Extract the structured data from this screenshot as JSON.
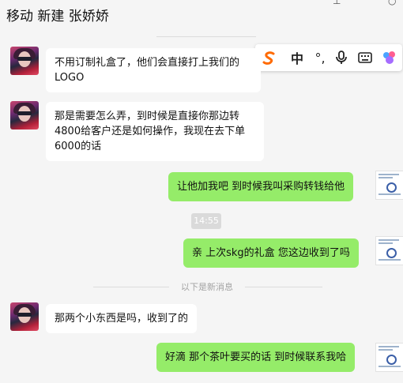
{
  "header": {
    "title": "移动 新建 张娇娇",
    "icons": [
      "minus-icon",
      "close-icon"
    ]
  },
  "ime_toolbar": {
    "logo_glyph": "S",
    "mode_label": "中",
    "punct_label": "°,",
    "icons": [
      "microphone-icon",
      "keyboard-icon",
      "skin-icon"
    ]
  },
  "messages": [
    {
      "side": "left",
      "text_lines": [
        "不用订制礼盒了，他们会直接打上我们的",
        "LOGO"
      ]
    },
    {
      "side": "left",
      "text_lines": [
        "那是需要怎么弄，到时候是直接你那边转",
        "4800给客户还是如何操作，我现在去下单",
        "6000的话"
      ]
    },
    {
      "side": "right",
      "text": "让他加我吧  到时候我叫采购转钱给他"
    },
    {
      "side": "right",
      "text": "亲 上次skg的礼盒 您这边收到了吗"
    },
    {
      "side": "left",
      "text": "那两个小东西是吗，收到了的"
    },
    {
      "side": "right",
      "text": "好滴 那个茶叶要买的话 到时候联系我哈"
    }
  ],
  "timestamp": "14:55",
  "new_messages_divider": "以下是新消息",
  "colors": {
    "background": "#f5f5f5",
    "sent_bubble": "#95ec69",
    "received_bubble": "#ffffff",
    "ime_logo": "#ff6a00"
  }
}
